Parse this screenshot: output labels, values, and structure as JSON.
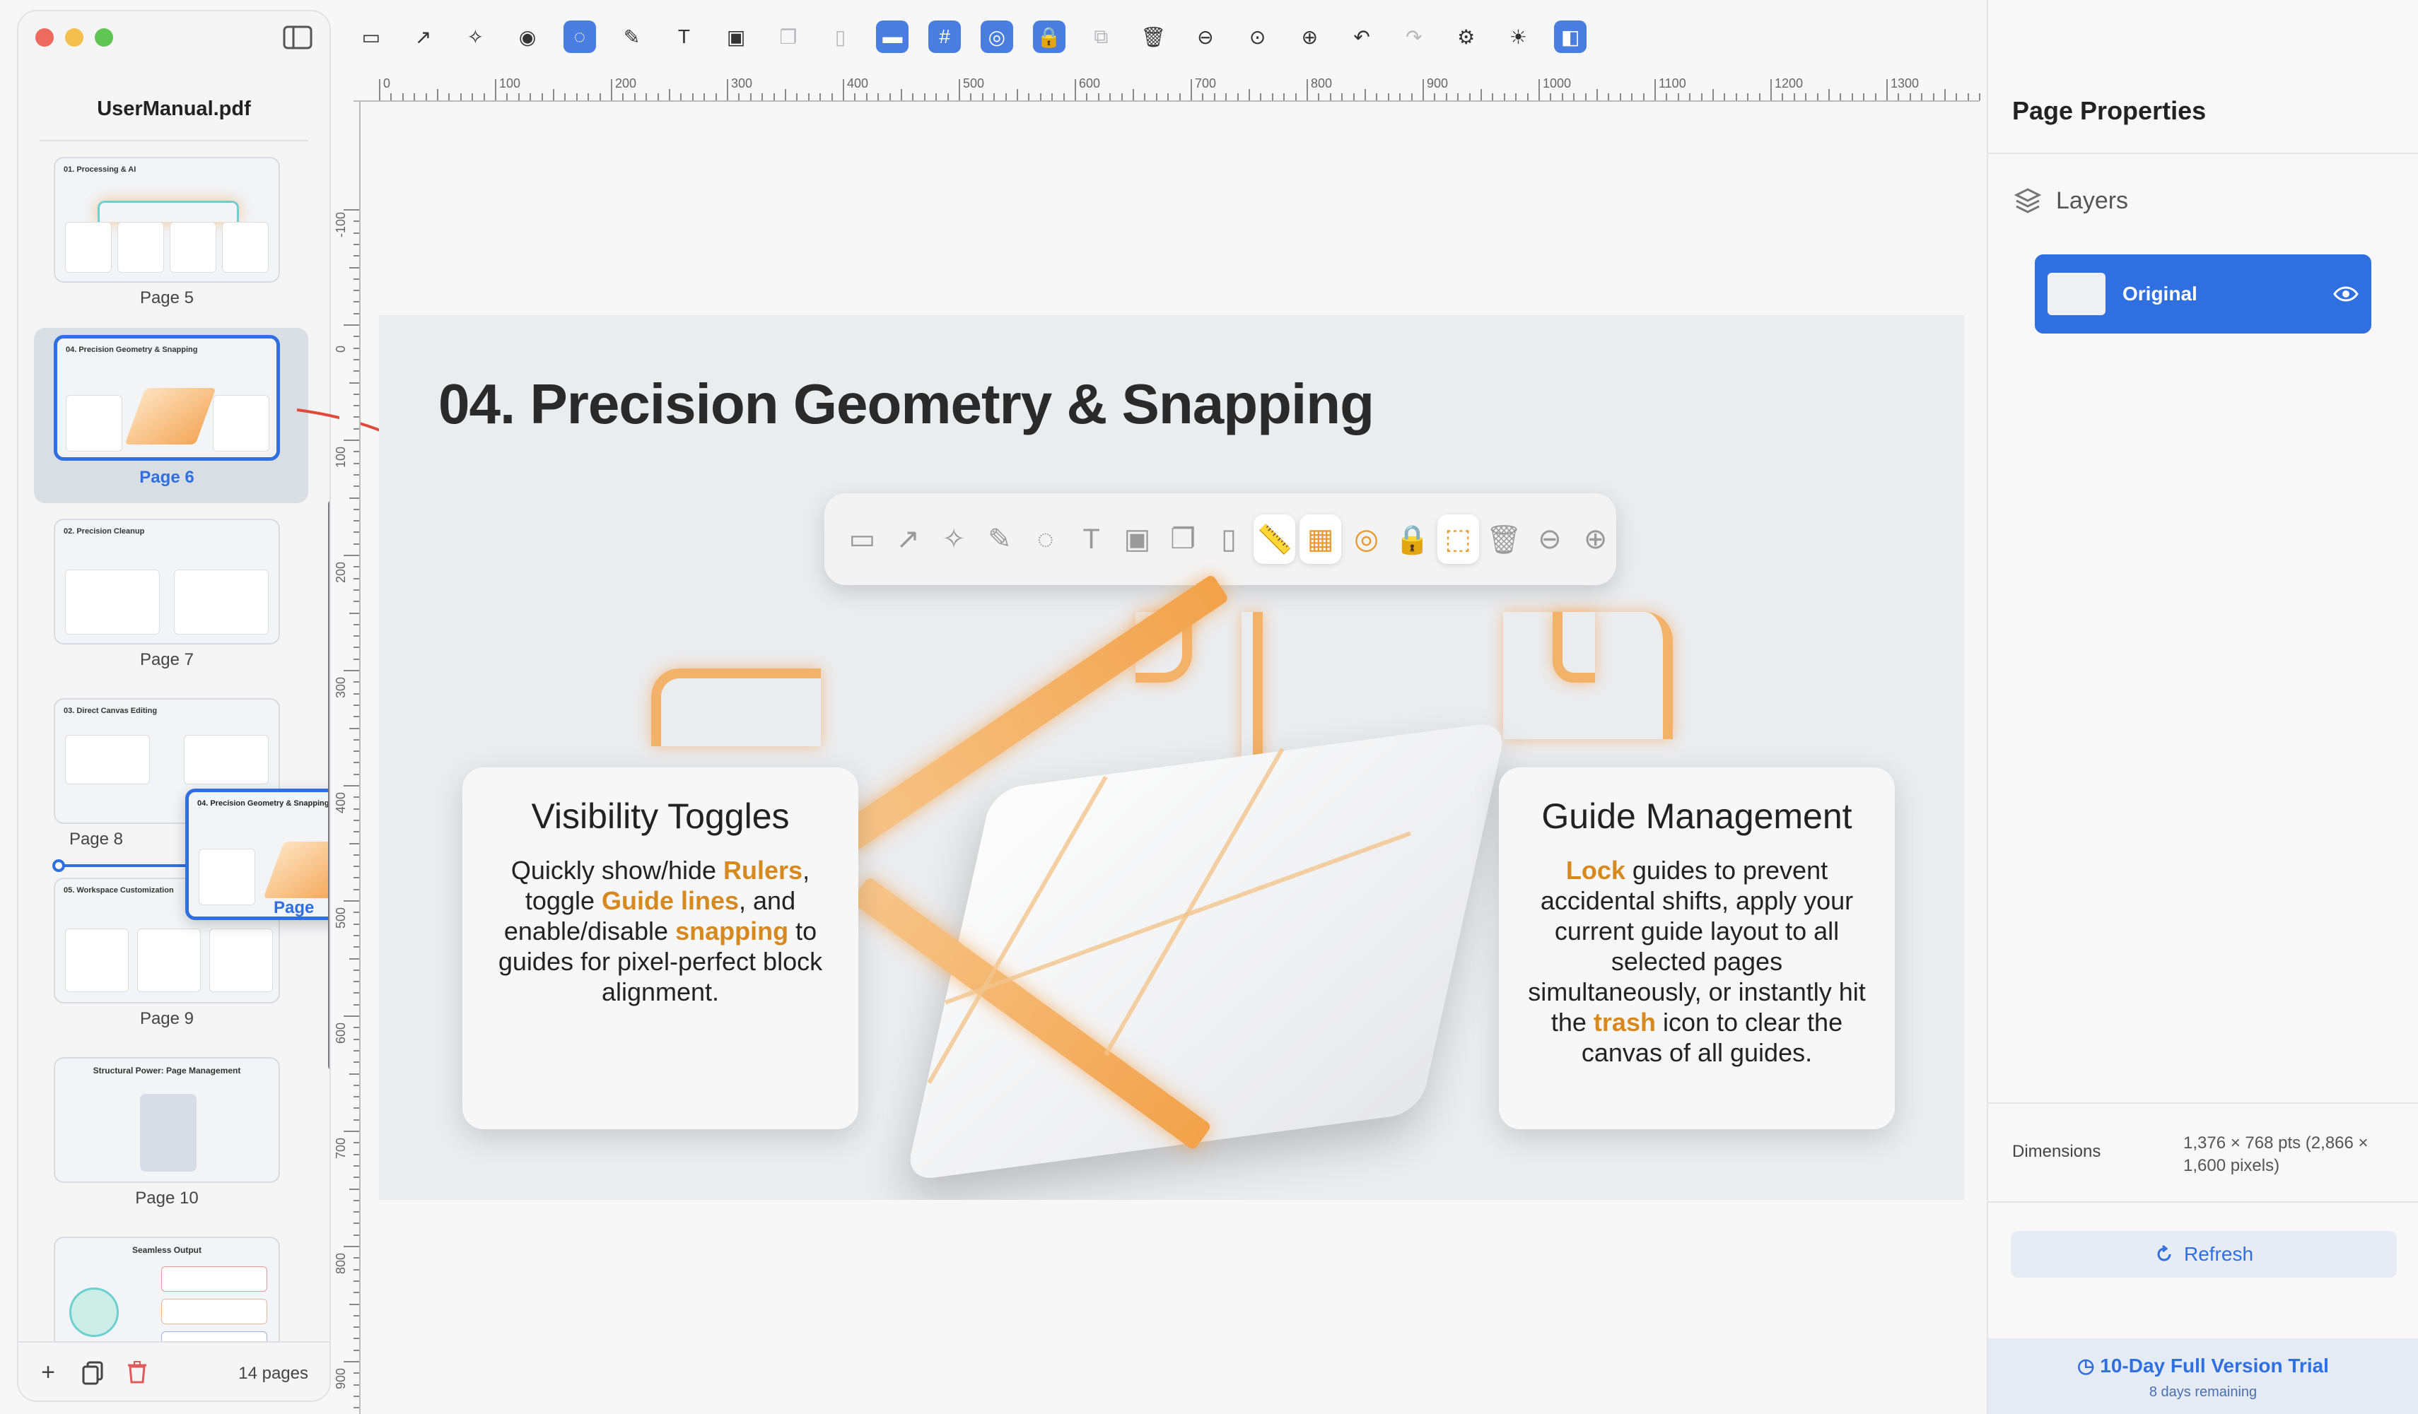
{
  "sidebar": {
    "document_title": "UserManual.pdf",
    "page_count": "14 pages",
    "thumbnails": [
      {
        "title": "01. Processing & AI",
        "label": "Page 5"
      },
      {
        "title": "04. Precision Geometry & Snapping",
        "label": "Page 6",
        "selected": true
      },
      {
        "title": "02. Precision Cleanup",
        "label": "Page 7"
      },
      {
        "title": "03. Direct Canvas Editing",
        "label": "Page 8"
      },
      {
        "title": "05. Workspace Customization",
        "label": "Page 9"
      },
      {
        "title": "Structural Power: Page Management",
        "label": "Page 10"
      },
      {
        "title": "Seamless Output",
        "label": ""
      }
    ],
    "drag_ghost": {
      "title": "04. Precision Geometry & Snapping",
      "label": "Page"
    }
  },
  "toolbar": {
    "items": [
      {
        "name": "layers-icon",
        "glyph": "▭",
        "state": "normal"
      },
      {
        "name": "export-icon",
        "glyph": "↗",
        "state": "normal"
      },
      {
        "name": "magic-wand-icon",
        "glyph": "✧",
        "state": "normal"
      },
      {
        "name": "eye-icon",
        "glyph": "◉",
        "state": "normal"
      },
      {
        "name": "lasso-icon",
        "glyph": "◌",
        "state": "active"
      },
      {
        "name": "brush-icon",
        "glyph": "✎",
        "state": "normal"
      },
      {
        "name": "text-icon",
        "glyph": "T",
        "state": "normal"
      },
      {
        "name": "image-icon",
        "glyph": "▣",
        "state": "normal"
      },
      {
        "name": "copy-icon",
        "glyph": "❐",
        "state": "disabled"
      },
      {
        "name": "clipboard-icon",
        "glyph": "▯",
        "state": "disabled"
      },
      {
        "name": "ruler-icon",
        "glyph": "▬",
        "state": "active"
      },
      {
        "name": "grid-icon",
        "glyph": "#",
        "state": "active"
      },
      {
        "name": "target-icon",
        "glyph": "◎",
        "state": "active"
      },
      {
        "name": "lock-icon",
        "glyph": "🔒",
        "state": "active"
      },
      {
        "name": "duplicate-icon",
        "glyph": "⧉",
        "state": "disabled"
      },
      {
        "name": "trash-icon",
        "glyph": "🗑",
        "state": "normal"
      },
      {
        "name": "zoom-out-icon",
        "glyph": "⊖",
        "state": "normal"
      },
      {
        "name": "zoom-reset-icon",
        "glyph": "⊙",
        "state": "normal"
      },
      {
        "name": "zoom-in-icon",
        "glyph": "⊕",
        "state": "normal"
      },
      {
        "name": "undo-icon",
        "glyph": "↶",
        "state": "normal"
      },
      {
        "name": "redo-icon",
        "glyph": "↷",
        "state": "disabled"
      },
      {
        "name": "settings-icon",
        "glyph": "⚙",
        "state": "normal"
      },
      {
        "name": "brightness-icon",
        "glyph": "☀",
        "state": "normal"
      },
      {
        "name": "panel-toggle-icon",
        "glyph": "◧",
        "state": "active"
      }
    ]
  },
  "ruler": {
    "h_labels": [
      "0",
      "100",
      "200",
      "300",
      "400",
      "500",
      "600",
      "700",
      "800",
      "900",
      "1000",
      "1100",
      "1200",
      "1300"
    ],
    "v_labels": [
      "-100",
      "0",
      "100",
      "200",
      "300",
      "400",
      "500",
      "600",
      "700",
      "800",
      "900"
    ]
  },
  "canvas": {
    "title": "04. Precision Geometry & Snapping",
    "left_card": {
      "heading": "Visibility Toggles",
      "parts": [
        "Quickly show/hide ",
        "Rulers",
        ", toggle ",
        "Guide lines",
        ", and enable/disable ",
        "snapping",
        " to guides for pixel-perfect block alignment."
      ]
    },
    "right_card": {
      "heading": "Guide Management",
      "parts": [
        "Lock",
        " guides to prevent accidental shifts, apply your current guide layout to all selected pages simultaneously, or instantly hit the ",
        "trash",
        " icon to clear the canvas of all guides."
      ]
    }
  },
  "panel": {
    "title": "Page Properties",
    "layers_heading": "Layers",
    "layer_name": "Original",
    "dimensions_label": "Dimensions",
    "dimensions_value": "1,376 × 768 pts (2,866 × 1,600 pixels)",
    "refresh_label": "Refresh",
    "trial_title": "10-Day Full Version Trial",
    "trial_sub": "8 days remaining"
  },
  "colors": {
    "accent": "#2f6fe0",
    "highlight": "#d6891f",
    "glow": "#f3b26a"
  }
}
